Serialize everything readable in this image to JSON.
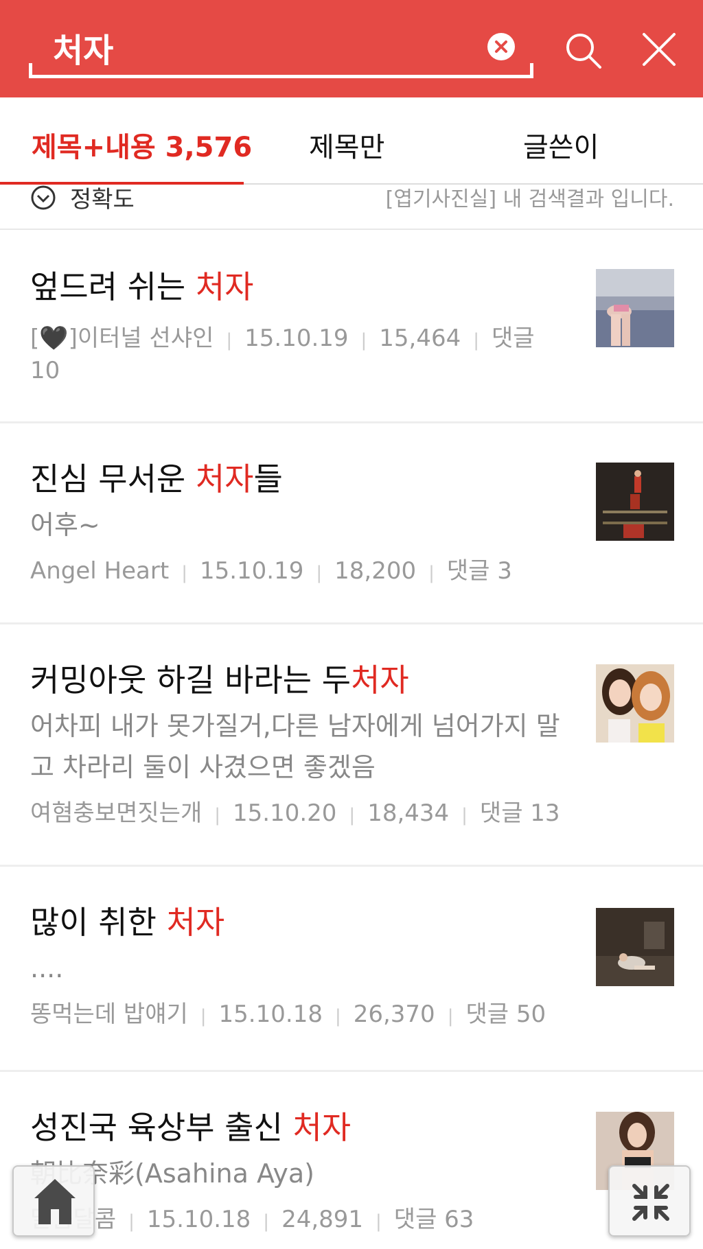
{
  "search": {
    "query": "처자"
  },
  "tabs": [
    {
      "label": "제목+내용 3,576",
      "active": true
    },
    {
      "label": "제목만",
      "active": false
    },
    {
      "label": "글쓴이",
      "active": false
    }
  ],
  "sort": {
    "label": "정확도",
    "info": "[엽기사진실] 내 검색결과 입니다."
  },
  "colors": {
    "header": "#e54a45",
    "highlight": "#e02a22"
  },
  "results": [
    {
      "title_pre": "엎드려 쉬는 ",
      "title_hl": "처자",
      "title_post": "",
      "desc": "",
      "author": "[🖤]이터널 선샤인",
      "date": "15.10.19",
      "views": "15,464",
      "comments": "댓글 10"
    },
    {
      "title_pre": "진심 무서운 ",
      "title_hl": "처자",
      "title_post": "들",
      "desc": "어후~",
      "author": "Angel Heart",
      "date": "15.10.19",
      "views": "18,200",
      "comments": "댓글 3"
    },
    {
      "title_pre": "커밍아웃 하길 바라는 두",
      "title_hl": "처자",
      "title_post": "",
      "desc": "어차피 내가 못가질거,다른 남자에게 넘어가지 말고 차라리 둘이 사겼으면 좋겠음",
      "author": "여혐충보면짓는개",
      "date": "15.10.20",
      "views": "18,434",
      "comments": "댓글 13"
    },
    {
      "title_pre": "많이 취한 ",
      "title_hl": "처자",
      "title_post": "",
      "desc": "....",
      "author": "똥먹는데 밥얘기",
      "date": "15.10.18",
      "views": "26,370",
      "comments": "댓글 50"
    },
    {
      "title_pre": "성진국 육상부 출신 ",
      "title_hl": "처자",
      "title_post": "",
      "desc": "朝比奈彩(Asahina Aya)",
      "author": "달콤달콤",
      "date": "15.10.18",
      "views": "24,891",
      "comments": "댓글 63"
    }
  ],
  "icons": {
    "clear": "clear-icon",
    "search": "search-icon",
    "close": "close-icon",
    "sort": "chevron-down-circle-icon",
    "home": "home-icon",
    "collapse": "collapse-icon"
  }
}
